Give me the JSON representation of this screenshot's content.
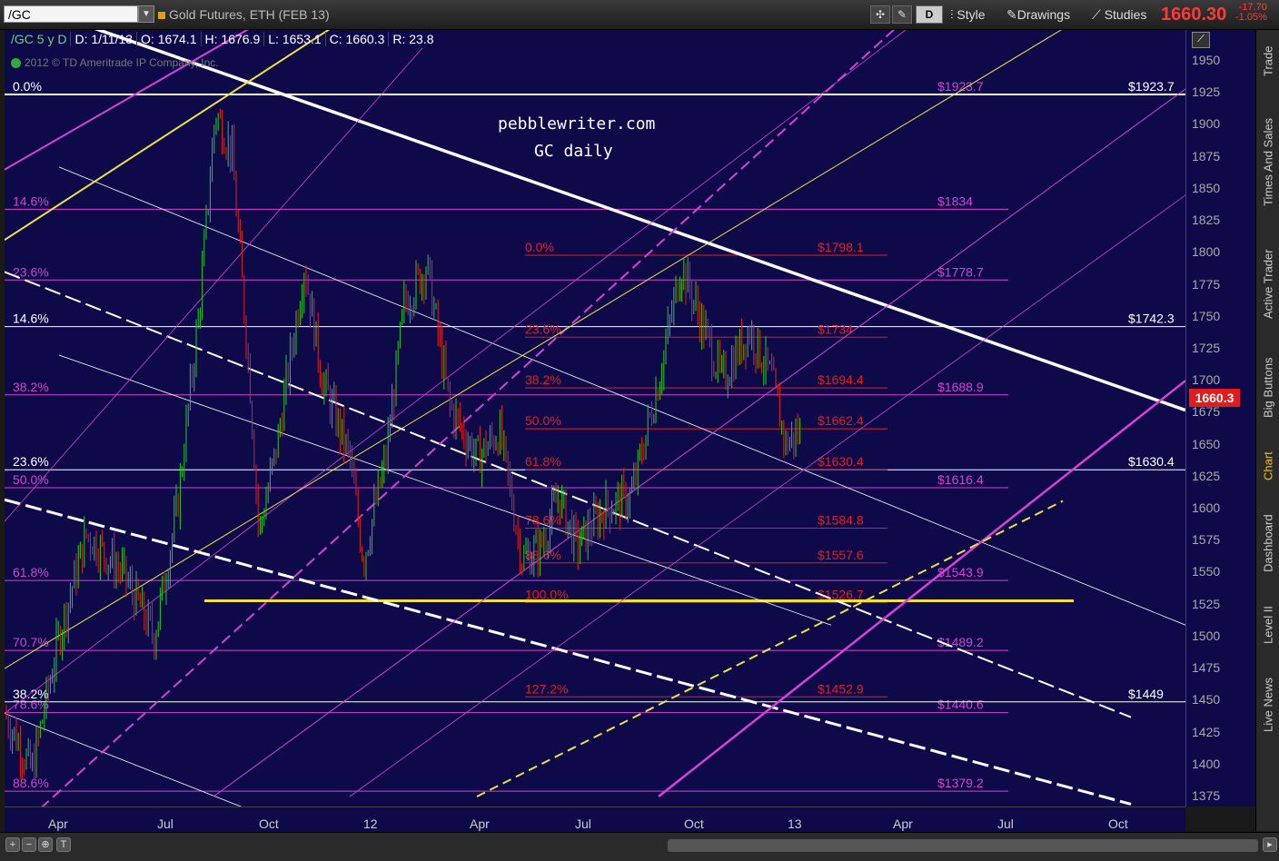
{
  "toolbar": {
    "symbol": "/GC",
    "description": "Gold Futures, ETH (FEB 13)",
    "aggregation": "D",
    "style_label": "Style",
    "drawings_label": "Drawings",
    "studies_label": "Studies",
    "last_price": "1660.30",
    "change_abs": "-17.70",
    "change_pct": "-1.05%"
  },
  "info": {
    "symbol_period": "/GC 5 y D",
    "date": "D: 1/11/13",
    "open": "O: 1674.1",
    "high": "H: 1676.9",
    "low": "L: 1653.1",
    "close": "C: 1660.3",
    "range": "R: 23.8"
  },
  "copyright": "2012 © TD Ameritrade IP Company, Inc.",
  "watermark": {
    "line1": "pebblewriter.com",
    "line2": "GC daily"
  },
  "price_tag": "1660.3",
  "y_ticks": [
    "1950",
    "1925",
    "1900",
    "1875",
    "1850",
    "1825",
    "1800",
    "1775",
    "1750",
    "1725",
    "1700",
    "1675",
    "1650",
    "1625",
    "1600",
    "1575",
    "1550",
    "1525",
    "1500",
    "1475",
    "1450",
    "1425",
    "1400",
    "1375"
  ],
  "x_ticks": [
    "Apr",
    "Jul",
    "Oct",
    "12",
    "Apr",
    "Jul",
    "Oct",
    "13",
    "Apr",
    "Jul",
    "Oct"
  ],
  "fib_white_left": [
    "0.0%",
    "14.6%",
    "23.6%",
    "38.2%"
  ],
  "fib_magenta_left": [
    "14.6%",
    "23.6%",
    "38.2%",
    "50.0%",
    "61.8%",
    "70.7%",
    "78.6%",
    "88.6%"
  ],
  "fib_magenta_right": [
    "$1923.7",
    "$1834",
    "$1778.7",
    "$1688.9",
    "$1616.4",
    "$1543.9",
    "$1489.2",
    "$1440.6",
    "$1379.2"
  ],
  "fib_white_right": [
    "$1923.7",
    "$1742.3",
    "$1630.4",
    "$1449"
  ],
  "fib_red_left": [
    "0.0%",
    "23.6%",
    "38.2%",
    "50.0%",
    "61.8%",
    "78.6%",
    "88.6%",
    "100.0%",
    "127.2%"
  ],
  "fib_red_right": [
    "$1798.1",
    "$1734",
    "$1694.4",
    "$1662.4",
    "$1630.4",
    "$1584.8",
    "$1557.6",
    "$1526.7",
    "$1452.9"
  ],
  "sidebar": [
    "Trade",
    "Times And Sales",
    "Active Trader",
    "Big Buttons",
    "Chart",
    "Dashboard",
    "Level II",
    "Live News"
  ],
  "colors": {
    "background": "#0e0a4a",
    "magenta": "#d642d6",
    "red": "#e02020",
    "yellow": "#f0e040",
    "white": "#ffffff",
    "up": "#22cc22",
    "down": "#dd2222"
  }
}
